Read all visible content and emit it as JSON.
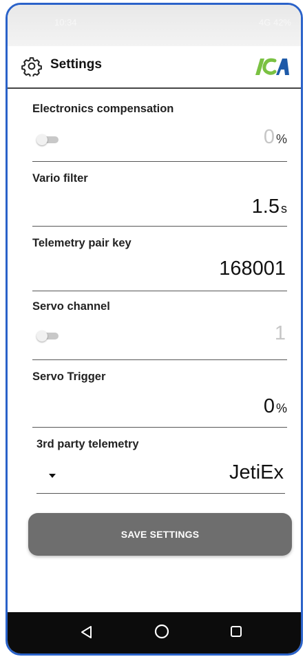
{
  "status_bar": {
    "time": "10:34",
    "right": "4G 42%"
  },
  "header": {
    "title": "Settings",
    "logo_text": "ICA",
    "icons": {
      "settings": "gear-icon",
      "logo": "ica-logo"
    }
  },
  "settings": [
    {
      "label": "Electronics compensation",
      "value": "0",
      "unit": "%",
      "has_toggle": true,
      "toggle_on": false,
      "value_disabled": true
    },
    {
      "label": "Vario filter",
      "value": "1.5",
      "unit": "s"
    },
    {
      "label": "Telemetry pair key",
      "value": "168001",
      "unit": ""
    },
    {
      "label": "Servo channel",
      "value": "1",
      "unit": "",
      "has_toggle": true,
      "toggle_on": false,
      "value_disabled": true
    },
    {
      "label": "Servo Trigger",
      "value": "0",
      "unit": "%"
    },
    {
      "label": "3rd party telemetry",
      "value": "JetiEx",
      "unit": "",
      "is_dropdown": true
    }
  ],
  "save_button": {
    "label": "SAVE SETTINGS"
  },
  "nav": {
    "back": "back-icon",
    "home": "home-icon",
    "recents": "recents-icon"
  },
  "colors": {
    "frame": "#2a62c9",
    "button": "#6e6e6e",
    "nav_bar": "#0c0c0c",
    "logo_green": "#7ac142",
    "logo_blue": "#1e5aa8"
  }
}
